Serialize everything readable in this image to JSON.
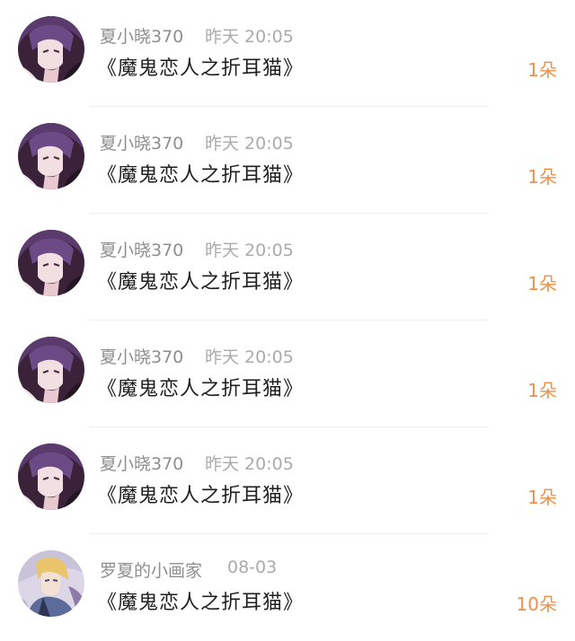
{
  "gifts": [
    {
      "user": "夏小晓370",
      "time": "昨天 20:05",
      "title": "《魔鬼恋人之折耳猫》",
      "count": "1朵",
      "avatar": "vampire-avatar"
    },
    {
      "user": "夏小晓370",
      "time": "昨天 20:05",
      "title": "《魔鬼恋人之折耳猫》",
      "count": "1朵",
      "avatar": "vampire-avatar"
    },
    {
      "user": "夏小晓370",
      "time": "昨天 20:05",
      "title": "《魔鬼恋人之折耳猫》",
      "count": "1朵",
      "avatar": "vampire-avatar"
    },
    {
      "user": "夏小晓370",
      "time": "昨天 20:05",
      "title": "《魔鬼恋人之折耳猫》",
      "count": "1朵",
      "avatar": "vampire-avatar"
    },
    {
      "user": "夏小晓370",
      "time": "昨天 20:05",
      "title": "《魔鬼恋人之折耳猫》",
      "count": "1朵",
      "avatar": "vampire-avatar"
    },
    {
      "user": "罗夏的小画家",
      "time": "08-03",
      "title": "《魔鬼恋人之折耳猫》",
      "count": "10朵",
      "avatar": "anime-boy-avatar"
    }
  ],
  "colors": {
    "accent": "#ef9048",
    "name": "#8e8e8e",
    "time": "#ababab",
    "title": "#1f1f1f",
    "divider": "#eeeeee"
  }
}
